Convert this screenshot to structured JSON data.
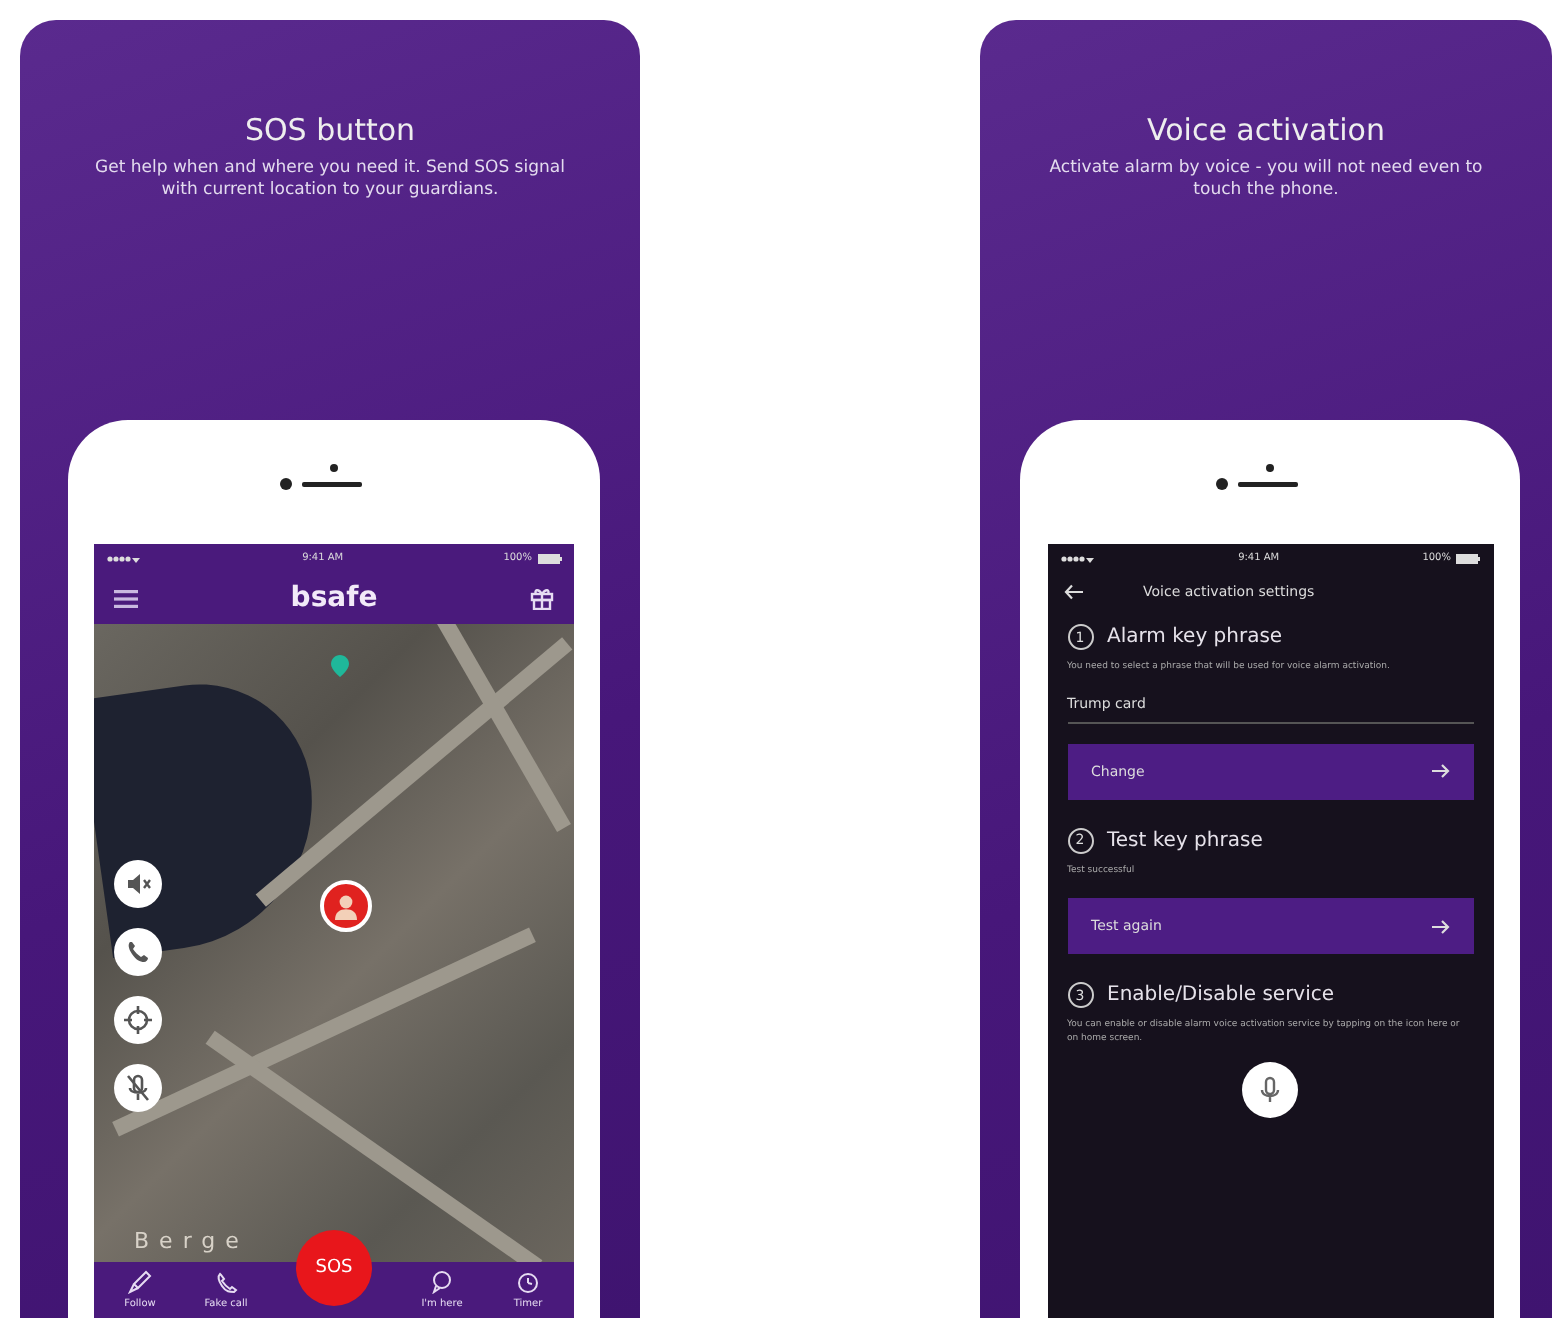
{
  "cards": [
    {
      "title": "SOS button",
      "description": "Get help when and where you need it. Send SOS signal with current location to your guardians.",
      "screen": {
        "kind": "map",
        "status_bar": {
          "time": "9:41 AM",
          "battery": "100%"
        },
        "logo": "bsafe",
        "map_label": "Berge",
        "sos_button": "SOS",
        "tab_bar": [
          {
            "label": "Follow"
          },
          {
            "label": "Fake call"
          },
          {
            "label": "I'm here"
          },
          {
            "label": "Timer"
          }
        ]
      }
    },
    {
      "title": "Voice activation",
      "description": "Activate alarm by voice - you will not need even to touch the phone.",
      "screen": {
        "kind": "settings",
        "status_bar": {
          "time": "9:41 AM",
          "battery": "100%"
        },
        "header": "Voice activation settings",
        "sections": [
          {
            "kind": "button",
            "number": "1",
            "title": "Alarm key phrase",
            "text": "You need to select a phrase that will be used for voice alarm activation.",
            "value": "Trump card",
            "button": "Change"
          },
          {
            "kind": "button",
            "number": "2",
            "title": "Test key phrase",
            "text": "Test successful",
            "button": "Test again"
          },
          {
            "kind": "icon",
            "number": "3",
            "title": "Enable/Disable service",
            "text": "You can enable or disable alarm voice activation service by tapping on the icon here or on home screen."
          }
        ]
      }
    }
  ]
}
